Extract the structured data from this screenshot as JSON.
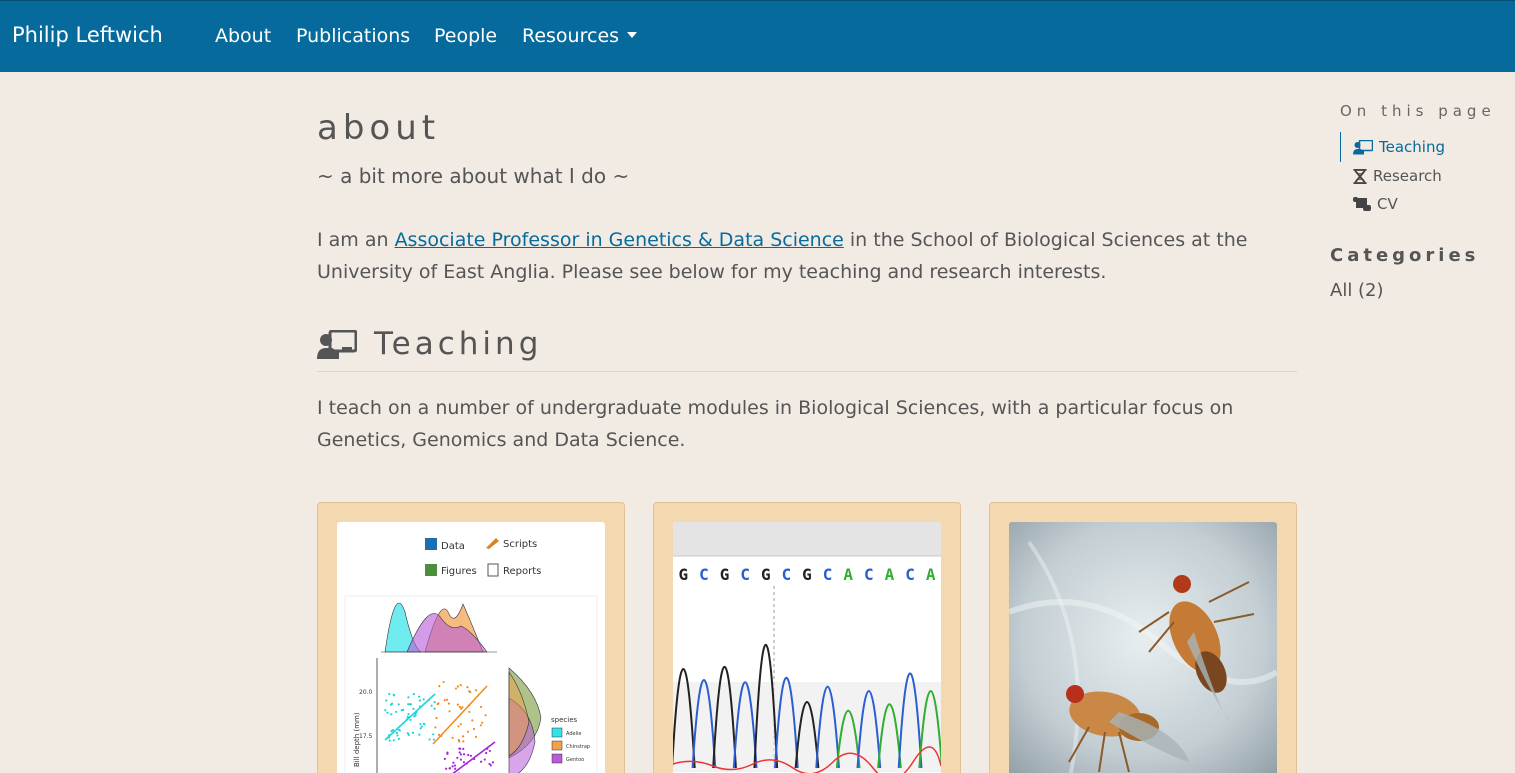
{
  "nav": {
    "brand": "Philip Leftwich",
    "items": [
      "About",
      "Publications",
      "People",
      "Resources"
    ]
  },
  "page": {
    "title": "about",
    "subtitle": "~ a bit more about what I do ~",
    "intro_before": "I am an ",
    "intro_link": "Associate Professor in Genetics & Data Science",
    "intro_after": " in the School of Biological Sciences at the University of East Anglia. Please see below for my teaching and research interests."
  },
  "teaching": {
    "title": "Teaching",
    "text": "I teach on a number of undergraduate modules in Biological Sciences, with a particular focus on Genetics, Genomics and Data Science."
  },
  "cards": [
    {
      "legend": [
        "Data",
        "Scripts",
        "Figures",
        "Reports"
      ],
      "axis_label": "Bill depth (mm)",
      "ticks": [
        "20.0",
        "17.5"
      ],
      "species_title": "species",
      "species": [
        "Adelie",
        "Chinstrap",
        "Gentoo"
      ]
    },
    {
      "sequence": [
        "G",
        "C",
        "G",
        "C",
        "G",
        "C",
        "G",
        "C",
        "A",
        "C",
        "A",
        "C",
        "A"
      ]
    },
    {}
  ],
  "toc": {
    "heading": "On this page",
    "items": [
      "Teaching",
      "Research",
      "CV"
    ]
  },
  "categories": {
    "heading": "Categories",
    "all": "All (2)"
  },
  "colors": {
    "navbar": "#066b9c",
    "background": "#f1ebe4",
    "card": "#f4d9b0",
    "link": "#066b9c"
  }
}
